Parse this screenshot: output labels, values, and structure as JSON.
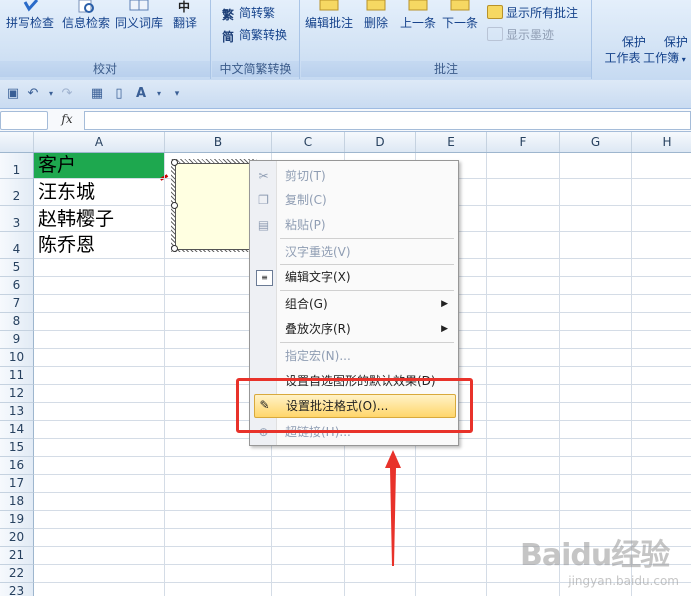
{
  "ribbon": {
    "proofing": {
      "label": "校对",
      "buttons": [
        "拼写检查",
        "信息检索",
        "同义词库",
        "翻译"
      ]
    },
    "chinese": {
      "label": "中文简繁转换",
      "buttons": [
        "简转繁",
        "简繁转换"
      ]
    },
    "comments": {
      "label": "批注",
      "buttons": [
        "编辑批注",
        "删除",
        "上一条",
        "下一条"
      ],
      "show_all": "显示所有批注",
      "show_ink": "显示墨迹"
    },
    "protect": {
      "buttons": [
        "保护\n工作表",
        "保护\n工作簿"
      ]
    }
  },
  "formula_bar": {
    "fx": "fx",
    "name_value": "",
    "formula_value": ""
  },
  "grid": {
    "columns": [
      "A",
      "B",
      "C",
      "D",
      "E",
      "F",
      "G",
      "H"
    ],
    "rows": [
      "1",
      "2",
      "3",
      "4",
      "5",
      "6",
      "7",
      "8",
      "9",
      "10",
      "11",
      "12",
      "13",
      "14",
      "15",
      "16",
      "17",
      "18",
      "19",
      "20",
      "21",
      "22",
      "23"
    ],
    "cells": {
      "A1": "客户",
      "A2": "汪东城",
      "A3": "赵韩樱子",
      "A4": "陈乔恩"
    },
    "a1_fill": "#1ea84f"
  },
  "context_menu": {
    "items": [
      {
        "label": "剪切(T)",
        "icon": "scissors-icon",
        "enabled": false
      },
      {
        "label": "复制(C)",
        "icon": "copy-icon",
        "enabled": false
      },
      {
        "label": "粘贴(P)",
        "icon": "paste-icon",
        "enabled": false
      },
      {
        "label": "汉字重选(V)",
        "icon": "",
        "enabled": false
      },
      {
        "label": "编辑文字(X)",
        "icon": "edit-text-icon",
        "enabled": true
      },
      {
        "label": "组合(G)",
        "icon": "",
        "enabled": true,
        "submenu": true
      },
      {
        "label": "叠放次序(R)",
        "icon": "",
        "enabled": true,
        "submenu": true
      },
      {
        "label": "指定宏(N)...",
        "icon": "",
        "enabled": false
      },
      {
        "label": "设置自选图形的默认效果(D)",
        "icon": "",
        "enabled": true
      },
      {
        "label": "设置批注格式(O)...",
        "icon": "format-comment-icon",
        "enabled": true,
        "highlighted": true
      },
      {
        "label": "超链接(H)...",
        "icon": "hyperlink-icon",
        "enabled": false
      }
    ]
  },
  "annotation_color": "#e8322a",
  "watermark": {
    "brand": "Baidu经验",
    "url": "jingyan.baidu.com"
  }
}
